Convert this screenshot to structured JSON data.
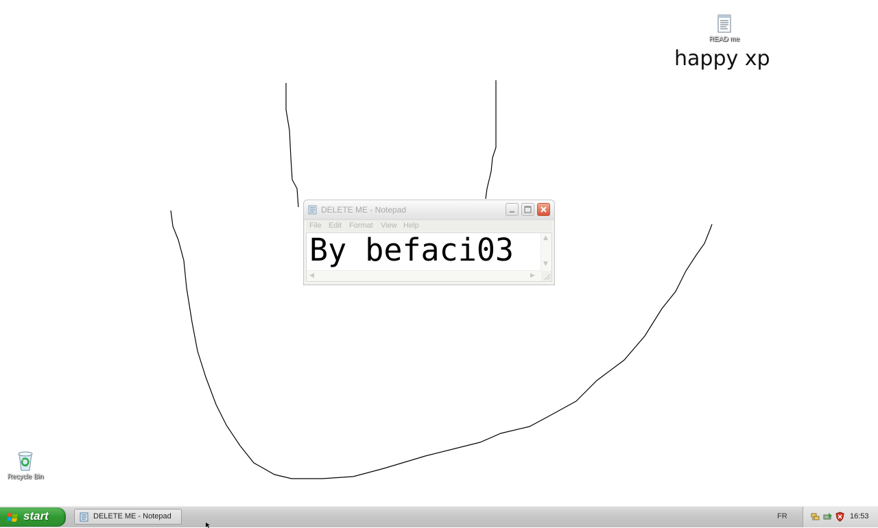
{
  "desktop": {
    "background_color": "#ffffff",
    "overlay_text": "happy xp",
    "icons": [
      {
        "label": "READ me",
        "icon": "text-document-icon"
      },
      {
        "label": "Recycle Bin",
        "icon": "recycle-bin-icon"
      }
    ]
  },
  "notepad": {
    "title": "DELETE ME - Notepad",
    "menu": [
      "File",
      "Edit",
      "Format",
      "View",
      "Help"
    ],
    "content": "By befaci03",
    "buttons": {
      "minimize": "minimize-icon",
      "maximize": "maximize-icon",
      "close": "close-icon"
    }
  },
  "taskbar": {
    "start_label": "start",
    "tasks": [
      {
        "label": "DELETE ME - Notepad",
        "icon": "notepad-icon"
      }
    ],
    "language": "FR",
    "tray_icons": [
      "network-icon",
      "safely-remove-icon",
      "security-shield-icon"
    ],
    "clock": "16:53"
  },
  "colors": {
    "start_green": "#2f9a31",
    "close_red": "#d7543a",
    "taskbar_gray": "#c9c9c9"
  }
}
